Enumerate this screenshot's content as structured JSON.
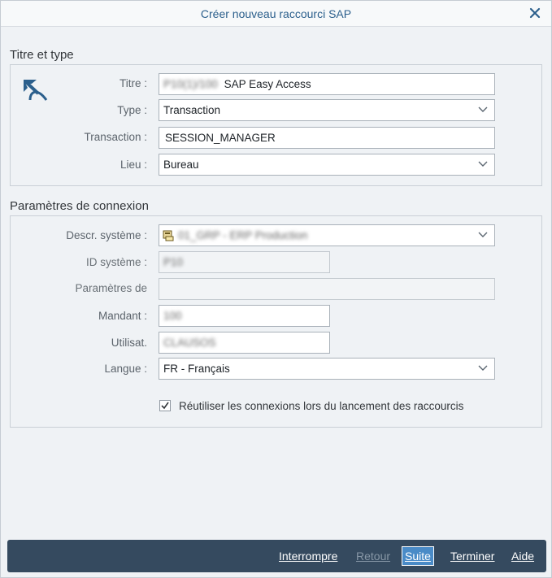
{
  "window": {
    "title": "Créer nouveau raccourci SAP"
  },
  "section1": {
    "heading": "Titre et type",
    "titre_label": "Titre :",
    "titre_prefix": "P10(1)/100",
    "titre_value": "SAP Easy Access",
    "type_label": "Type :",
    "type_value": "Transaction",
    "transaction_label": "Transaction :",
    "transaction_value": "SESSION_MANAGER",
    "lieu_label": "Lieu :",
    "lieu_value": "Bureau"
  },
  "section2": {
    "heading": "Paramètres de connexion",
    "descr_label": "Descr. système :",
    "descr_value": "01_GRP - ERP Production",
    "idsys_label": "ID système :",
    "idsys_value": "P10",
    "params_label": "Paramètres de",
    "params_value": "",
    "mandant_label": "Mandant :",
    "mandant_value": "100",
    "user_label": "Utilisat.",
    "user_value": "CLAUSOS",
    "langue_label": "Langue :",
    "langue_value": "FR - Français",
    "reuse_label": "Réutiliser les connexions lors du lancement des raccourcis",
    "reuse_checked": true
  },
  "footer": {
    "interrompre": "Interrompre",
    "retour": "Retour",
    "suite": "Suite",
    "terminer": "Terminer",
    "aide": "Aide"
  },
  "colors": {
    "accent": "#2b5f8c",
    "footer_bg": "#354a5f",
    "primary_button": "#4a8bc7"
  },
  "icons": {
    "shortcut": "shortcut-arrow-icon",
    "system": "system-server-icon",
    "close": "close-icon",
    "dropdown": "chevron-down-icon",
    "check": "checkmark-icon"
  }
}
